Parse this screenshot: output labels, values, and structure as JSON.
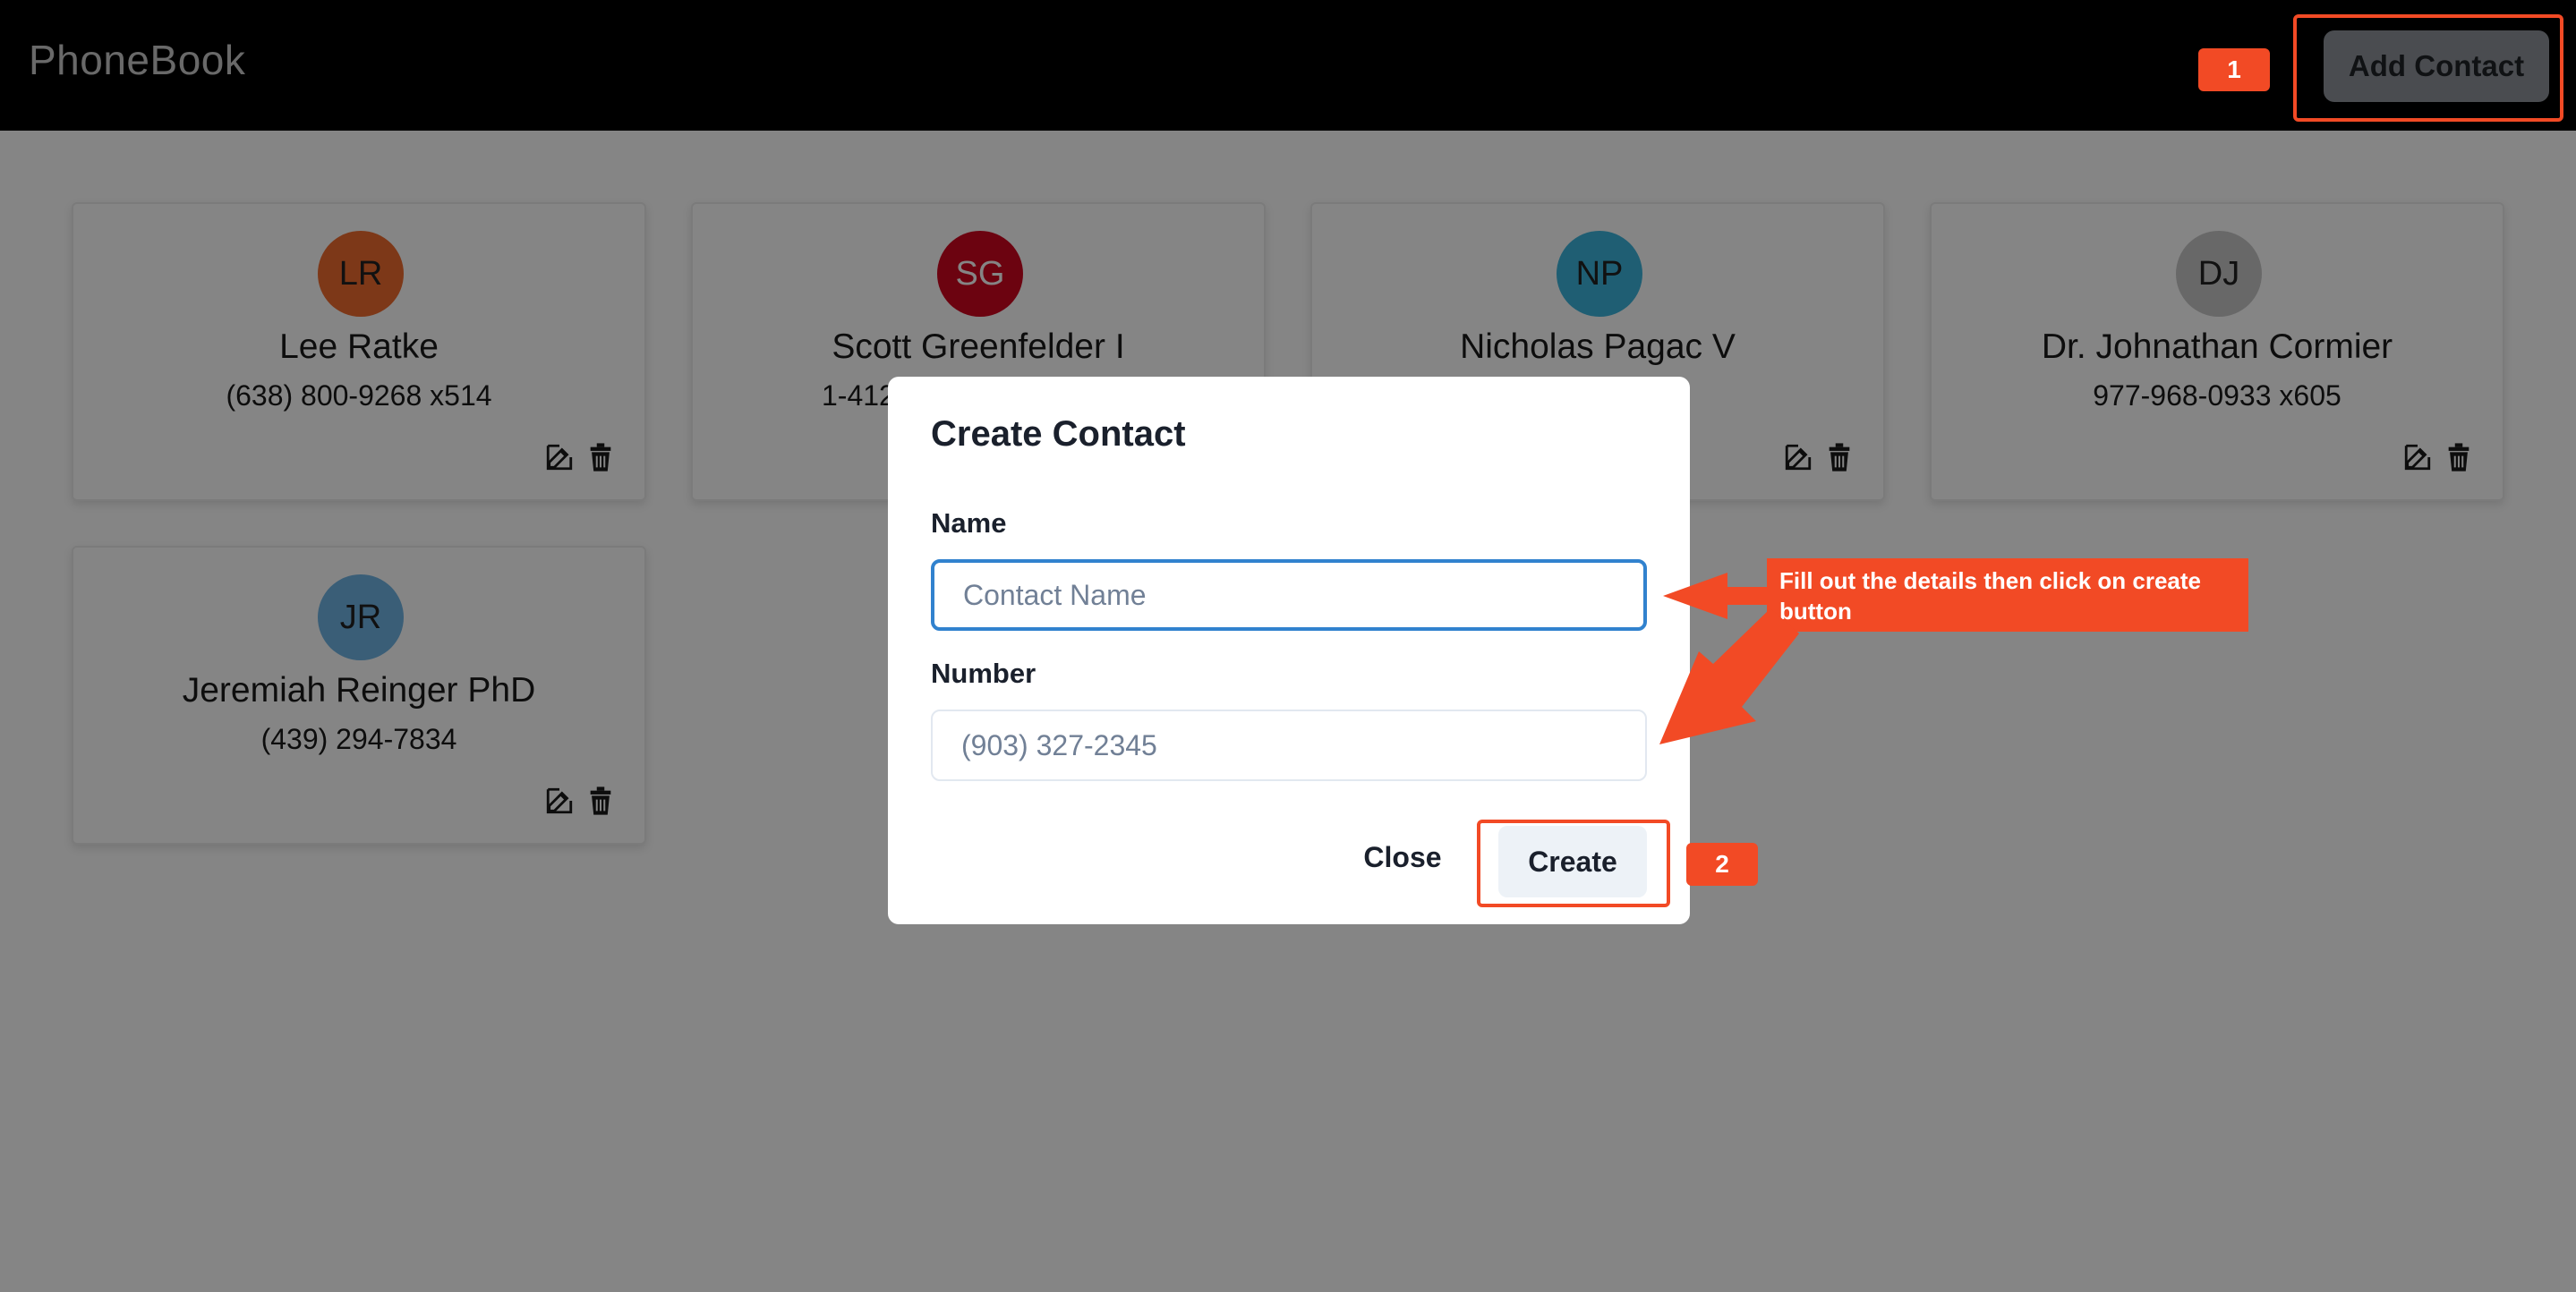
{
  "header": {
    "brand": "PhoneBook",
    "add_contact_label": "Add Contact"
  },
  "contacts": [
    {
      "initials": "LR",
      "name": "Lee Ratke",
      "phone": "(638) 800-9268 x514",
      "avatar_color": "#f06b2f"
    },
    {
      "initials": "SG",
      "name": "Scott Greenfelder I",
      "phone": "1-412",
      "avatar_color": "#d0061f"
    },
    {
      "initials": "NP",
      "name": "Nicholas Pagac V",
      "phone": "",
      "avatar_color": "#3cb5dc"
    },
    {
      "initials": "DJ",
      "name": "Dr. Johnathan Cormier",
      "phone": "977-968-0933 x605",
      "avatar_color": "#c8c8c8"
    },
    {
      "initials": "JR",
      "name": "Jeremiah Reinger PhD",
      "phone": "(439) 294-7834",
      "avatar_color": "#6fb4e4"
    }
  ],
  "modal": {
    "title": "Create Contact",
    "name_label": "Name",
    "name_value": "",
    "name_placeholder": "Contact Name",
    "number_label": "Number",
    "number_value": "",
    "number_placeholder": "(903) 327-2345",
    "close_label": "Close",
    "create_label": "Create"
  },
  "annotations": {
    "step1": "1",
    "step2": "2",
    "callout": "Fill out the details then click on create button",
    "color": "#f24a25"
  },
  "icons": {
    "edit": "edit-icon",
    "delete": "trash-icon"
  }
}
